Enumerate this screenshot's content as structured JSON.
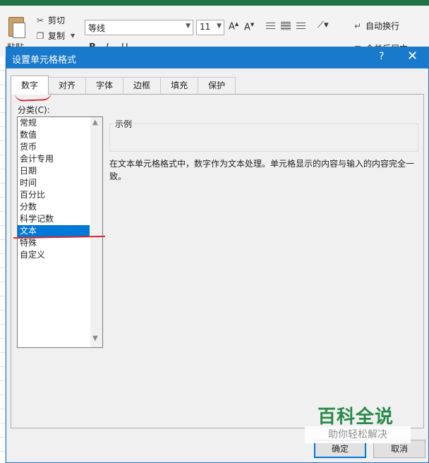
{
  "ribbon": {
    "paste_label": "粘贴",
    "cut_label": "剪切",
    "copy_label": "复制",
    "font_name": "等线",
    "font_size": "11",
    "wrap_text_label": "自动换行",
    "merge_label": "合并后居中",
    "bold": "B",
    "italic": "I",
    "underline": "U"
  },
  "dialog": {
    "title": "设置单元格格式",
    "help": "?",
    "close": "✕",
    "tabs": [
      "数字",
      "对齐",
      "字体",
      "边框",
      "填充",
      "保护"
    ],
    "active_tab": "数字",
    "category_label": "分类(C):",
    "categories": [
      "常规",
      "数值",
      "货币",
      "会计专用",
      "日期",
      "时间",
      "百分比",
      "分数",
      "科学记数",
      "文本",
      "特殊",
      "自定义"
    ],
    "selected_category": "文本",
    "sample_label": "示例",
    "description": "在文本单元格格式中，数字作为文本处理。单元格显示的内容与输入的内容完全一致。",
    "ok_label": "确定",
    "cancel_label": "取消"
  },
  "watermark": {
    "title": "百科全说",
    "subtitle": "助你轻松解决"
  },
  "colors": {
    "titlebar": "#1979ca",
    "selection": "#0078d7",
    "annotation_red": "#d9262b",
    "excel_green": "#217346",
    "watermark_green": "#2a8a4a"
  }
}
